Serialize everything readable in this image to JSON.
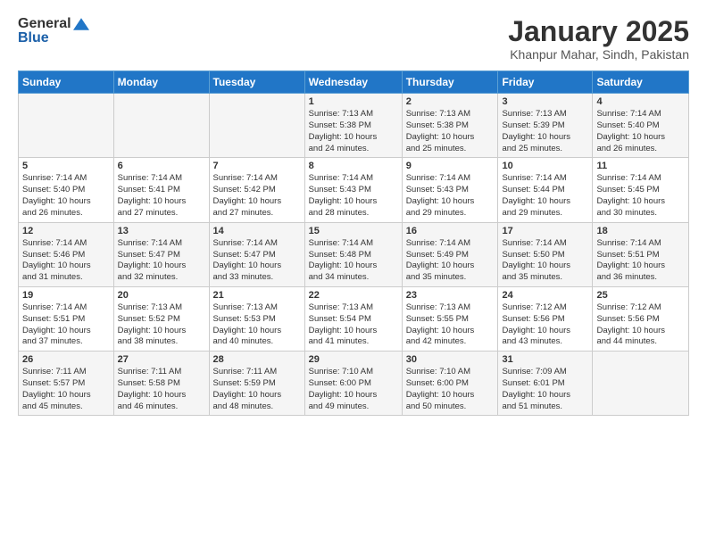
{
  "header": {
    "logo_line1": "General",
    "logo_line2": "Blue",
    "month": "January 2025",
    "location": "Khanpur Mahar, Sindh, Pakistan"
  },
  "days_of_week": [
    "Sunday",
    "Monday",
    "Tuesday",
    "Wednesday",
    "Thursday",
    "Friday",
    "Saturday"
  ],
  "weeks": [
    [
      {
        "day": "",
        "info": ""
      },
      {
        "day": "",
        "info": ""
      },
      {
        "day": "",
        "info": ""
      },
      {
        "day": "1",
        "info": "Sunrise: 7:13 AM\nSunset: 5:38 PM\nDaylight: 10 hours\nand 24 minutes."
      },
      {
        "day": "2",
        "info": "Sunrise: 7:13 AM\nSunset: 5:38 PM\nDaylight: 10 hours\nand 25 minutes."
      },
      {
        "day": "3",
        "info": "Sunrise: 7:13 AM\nSunset: 5:39 PM\nDaylight: 10 hours\nand 25 minutes."
      },
      {
        "day": "4",
        "info": "Sunrise: 7:14 AM\nSunset: 5:40 PM\nDaylight: 10 hours\nand 26 minutes."
      }
    ],
    [
      {
        "day": "5",
        "info": "Sunrise: 7:14 AM\nSunset: 5:40 PM\nDaylight: 10 hours\nand 26 minutes."
      },
      {
        "day": "6",
        "info": "Sunrise: 7:14 AM\nSunset: 5:41 PM\nDaylight: 10 hours\nand 27 minutes."
      },
      {
        "day": "7",
        "info": "Sunrise: 7:14 AM\nSunset: 5:42 PM\nDaylight: 10 hours\nand 27 minutes."
      },
      {
        "day": "8",
        "info": "Sunrise: 7:14 AM\nSunset: 5:43 PM\nDaylight: 10 hours\nand 28 minutes."
      },
      {
        "day": "9",
        "info": "Sunrise: 7:14 AM\nSunset: 5:43 PM\nDaylight: 10 hours\nand 29 minutes."
      },
      {
        "day": "10",
        "info": "Sunrise: 7:14 AM\nSunset: 5:44 PM\nDaylight: 10 hours\nand 29 minutes."
      },
      {
        "day": "11",
        "info": "Sunrise: 7:14 AM\nSunset: 5:45 PM\nDaylight: 10 hours\nand 30 minutes."
      }
    ],
    [
      {
        "day": "12",
        "info": "Sunrise: 7:14 AM\nSunset: 5:46 PM\nDaylight: 10 hours\nand 31 minutes."
      },
      {
        "day": "13",
        "info": "Sunrise: 7:14 AM\nSunset: 5:47 PM\nDaylight: 10 hours\nand 32 minutes."
      },
      {
        "day": "14",
        "info": "Sunrise: 7:14 AM\nSunset: 5:47 PM\nDaylight: 10 hours\nand 33 minutes."
      },
      {
        "day": "15",
        "info": "Sunrise: 7:14 AM\nSunset: 5:48 PM\nDaylight: 10 hours\nand 34 minutes."
      },
      {
        "day": "16",
        "info": "Sunrise: 7:14 AM\nSunset: 5:49 PM\nDaylight: 10 hours\nand 35 minutes."
      },
      {
        "day": "17",
        "info": "Sunrise: 7:14 AM\nSunset: 5:50 PM\nDaylight: 10 hours\nand 35 minutes."
      },
      {
        "day": "18",
        "info": "Sunrise: 7:14 AM\nSunset: 5:51 PM\nDaylight: 10 hours\nand 36 minutes."
      }
    ],
    [
      {
        "day": "19",
        "info": "Sunrise: 7:14 AM\nSunset: 5:51 PM\nDaylight: 10 hours\nand 37 minutes."
      },
      {
        "day": "20",
        "info": "Sunrise: 7:13 AM\nSunset: 5:52 PM\nDaylight: 10 hours\nand 38 minutes."
      },
      {
        "day": "21",
        "info": "Sunrise: 7:13 AM\nSunset: 5:53 PM\nDaylight: 10 hours\nand 40 minutes."
      },
      {
        "day": "22",
        "info": "Sunrise: 7:13 AM\nSunset: 5:54 PM\nDaylight: 10 hours\nand 41 minutes."
      },
      {
        "day": "23",
        "info": "Sunrise: 7:13 AM\nSunset: 5:55 PM\nDaylight: 10 hours\nand 42 minutes."
      },
      {
        "day": "24",
        "info": "Sunrise: 7:12 AM\nSunset: 5:56 PM\nDaylight: 10 hours\nand 43 minutes."
      },
      {
        "day": "25",
        "info": "Sunrise: 7:12 AM\nSunset: 5:56 PM\nDaylight: 10 hours\nand 44 minutes."
      }
    ],
    [
      {
        "day": "26",
        "info": "Sunrise: 7:11 AM\nSunset: 5:57 PM\nDaylight: 10 hours\nand 45 minutes."
      },
      {
        "day": "27",
        "info": "Sunrise: 7:11 AM\nSunset: 5:58 PM\nDaylight: 10 hours\nand 46 minutes."
      },
      {
        "day": "28",
        "info": "Sunrise: 7:11 AM\nSunset: 5:59 PM\nDaylight: 10 hours\nand 48 minutes."
      },
      {
        "day": "29",
        "info": "Sunrise: 7:10 AM\nSunset: 6:00 PM\nDaylight: 10 hours\nand 49 minutes."
      },
      {
        "day": "30",
        "info": "Sunrise: 7:10 AM\nSunset: 6:00 PM\nDaylight: 10 hours\nand 50 minutes."
      },
      {
        "day": "31",
        "info": "Sunrise: 7:09 AM\nSunset: 6:01 PM\nDaylight: 10 hours\nand 51 minutes."
      },
      {
        "day": "",
        "info": ""
      }
    ]
  ]
}
